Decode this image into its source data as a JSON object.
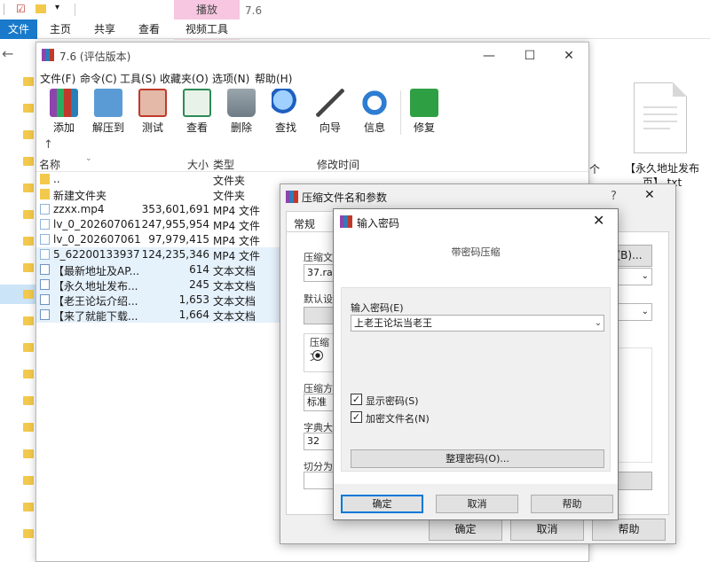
{
  "explorer": {
    "quick_checkbox": "☑",
    "window_title": "7.6",
    "context_tab_header": "播放",
    "ribbon_tabs": [
      "文件",
      "主页",
      "共享",
      "查看",
      "视频工具"
    ],
    "right_file_label": "【永久地址发布页】.txt",
    "partial_text": "个",
    "back_arrow": "←"
  },
  "rar": {
    "title": "7.6 (评估版本)",
    "menu": [
      "文件(F)",
      "命令(C)",
      "工具(S)",
      "收藏夹(O)",
      "选项(N)",
      "帮助(H)"
    ],
    "toolbar": [
      {
        "label": "添加",
        "icon": "books-add-icon",
        "color": "#c0392b"
      },
      {
        "label": "解压到",
        "icon": "folder-extract-icon",
        "color": "#3a7bd5"
      },
      {
        "label": "测试",
        "icon": "test-clipboard-icon",
        "color": "#d94a3a"
      },
      {
        "label": "查看",
        "icon": "book-view-icon",
        "color": "#3aa35b"
      },
      {
        "label": "删除",
        "icon": "trash-icon",
        "color": "#7f8c8d"
      },
      {
        "label": "查找",
        "icon": "magnifier-icon",
        "color": "#2f80ed"
      },
      {
        "label": "向导",
        "icon": "wand-icon",
        "color": "#6c5ce7"
      },
      {
        "label": "信息",
        "icon": "info-icon",
        "color": "#2d7dd2"
      },
      {
        "label": "修复",
        "icon": "repair-kit-icon",
        "color": "#27ae60"
      }
    ],
    "up_arrow": "↑",
    "columns": {
      "name": "名称",
      "size": "大小",
      "type": "类型",
      "modified": "修改时间"
    },
    "files": [
      {
        "name": "..",
        "size": "",
        "type": "文件夹",
        "icon": "folder-icon"
      },
      {
        "name": "新建文件夹",
        "size": "",
        "type": "文件夹",
        "icon": "folder-icon"
      },
      {
        "name": "zzxx.mp4",
        "size": "353,601,691",
        "type": "MP4 文件",
        "icon": "video-file-icon"
      },
      {
        "name": "lv_0_202607061...",
        "size": "247,955,954",
        "type": "MP4 文件",
        "icon": "video-file-icon"
      },
      {
        "name": "lv_0_202607061...",
        "size": "97,979,415",
        "type": "MP4 文件",
        "icon": "video-file-icon"
      },
      {
        "name": "5_62200133937...",
        "size": "124,235,346",
        "type": "MP4 文件",
        "icon": "video-file-icon"
      },
      {
        "name": "【最新地址及AP...",
        "size": "614",
        "type": "文本文档",
        "icon": "text-file-icon"
      },
      {
        "name": "【永久地址发布...",
        "size": "245",
        "type": "文本文档",
        "icon": "text-file-icon"
      },
      {
        "name": "【老王论坛介绍...",
        "size": "1,653",
        "type": "文本文档",
        "icon": "text-file-icon"
      },
      {
        "name": "【来了就能下载...",
        "size": "1,664",
        "type": "文本文档",
        "icon": "text-file-icon"
      }
    ]
  },
  "params": {
    "title": "压缩文件名和参数",
    "help_glyph": "?",
    "tab": "常规",
    "archive_label": "压缩文",
    "archive_value": "37.rar",
    "browse_partial": "(B)...",
    "profile_label": "默认设",
    "format_label": "压缩文",
    "method_label": "压缩方",
    "method_value": "标准",
    "dict_label": "字典大",
    "dict_value": "32",
    "split_label": "切分为",
    "ok": "确定",
    "cancel": "取消",
    "help": "帮助"
  },
  "password": {
    "title": "输入密码",
    "subtitle": "带密码压缩",
    "input_label": "输入密码(E)",
    "input_value": "上老王论坛当老王",
    "show_password": "显示密码(S)",
    "encrypt_filenames": "加密文件名(N)",
    "organize_button": "整理密码(O)...",
    "ok": "确定",
    "cancel": "取消",
    "help": "帮助",
    "show_checked": true,
    "encrypt_checked": true
  }
}
